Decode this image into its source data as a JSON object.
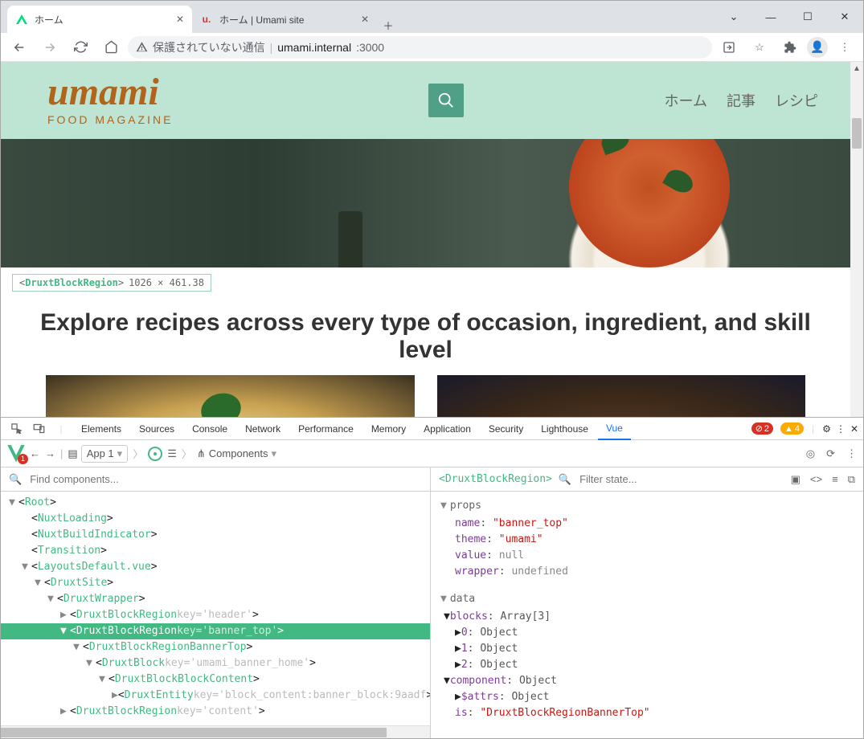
{
  "window": {
    "chevron": "⌄",
    "min": "—",
    "max": "□",
    "close": "✕"
  },
  "tabs": [
    {
      "title": "ホーム",
      "favColor": "#00dc82"
    },
    {
      "title": "ホーム | Umami site",
      "favColor": "#d93025"
    }
  ],
  "newtab": "+",
  "nav": {
    "back": "←",
    "fwd": "→",
    "reload": "⟳",
    "home": "⌂"
  },
  "urlbar": {
    "warn": "▲",
    "security": "保護されていない通信",
    "host": "umami.internal",
    "port": ":3000",
    "share": "⇪",
    "star": "☆",
    "ext": "✦",
    "menu": "⋮"
  },
  "site": {
    "logo": "umami",
    "logo_sub": "FOOD MAGAZINE",
    "menu": [
      "ホーム",
      "記事",
      "レシピ"
    ],
    "headline": "Explore recipes across every type of occasion, ingredient, and skill level"
  },
  "badge": {
    "comp": "DruxtBlockRegion",
    "dim": "1026 × 461.38"
  },
  "devtools": {
    "icons": {
      "inspect": "⬚",
      "device": "▭",
      "gear": "⚙",
      "more": "⋮",
      "close": "✕"
    },
    "tabs": [
      "Elements",
      "Sources",
      "Console",
      "Network",
      "Performance",
      "Memory",
      "Application",
      "Security",
      "Lighthouse",
      "Vue"
    ],
    "active": "Vue",
    "errors": "2",
    "warnings": "4",
    "bar": {
      "badge": "1",
      "back": "←",
      "fwd": "→",
      "app": "App 1",
      "components": "Components",
      "crosshair": "⊕",
      "refresh": "⟳",
      "menu": "⋮"
    },
    "find_placeholder": "Find components...",
    "inspected": "<DruxtBlockRegion>",
    "filter_placeholder": "Filter state...",
    "ricons": [
      "▦",
      "<>",
      "≡",
      "⧉"
    ],
    "tree": [
      {
        "d": 0,
        "a": "▼",
        "t": "Root"
      },
      {
        "d": 1,
        "a": "",
        "t": "NuxtLoading"
      },
      {
        "d": 1,
        "a": "",
        "t": "NuxtBuildIndicator"
      },
      {
        "d": 1,
        "a": "",
        "t": "Transition"
      },
      {
        "d": 1,
        "a": "▼",
        "t": "LayoutsDefault.vue"
      },
      {
        "d": 2,
        "a": "▼",
        "t": "DruxtSite"
      },
      {
        "d": 3,
        "a": "▼",
        "t": "DruxtWrapper"
      },
      {
        "d": 4,
        "a": "▶",
        "t": "DruxtBlockRegion",
        "attr": "key='header'"
      },
      {
        "d": 4,
        "a": "▼",
        "t": "DruxtBlockRegion",
        "attr": "key='banner_top'",
        "sel": true
      },
      {
        "d": 5,
        "a": "▼",
        "t": "DruxtBlockRegionBannerTop"
      },
      {
        "d": 6,
        "a": "▼",
        "t": "DruxtBlock",
        "attr": "key='umami_banner_home'"
      },
      {
        "d": 7,
        "a": "▼",
        "t": "DruxtBlockBlockContent"
      },
      {
        "d": 8,
        "a": "▶",
        "t": "DruxtEntity",
        "attr": "key='block_content:banner_block:9aadf"
      },
      {
        "d": 4,
        "a": "▶",
        "t": "DruxtBlockRegion",
        "attr": "key='content'"
      }
    ],
    "props_title": "props",
    "props": [
      {
        "k": "name",
        "v": "\"banner_top\"",
        "t": "s"
      },
      {
        "k": "theme",
        "v": "\"umami\"",
        "t": "s"
      },
      {
        "k": "value",
        "v": "null",
        "t": "n"
      },
      {
        "k": "wrapper",
        "v": "undefined",
        "t": "n"
      }
    ],
    "data_title": "data",
    "data": [
      {
        "d": 0,
        "a": "▼",
        "k": "blocks",
        "v": "Array[3]"
      },
      {
        "d": 1,
        "a": "▶",
        "k": "0",
        "v": "Object"
      },
      {
        "d": 1,
        "a": "▶",
        "k": "1",
        "v": "Object"
      },
      {
        "d": 1,
        "a": "▶",
        "k": "2",
        "v": "Object"
      },
      {
        "d": 0,
        "a": "▼",
        "k": "component",
        "v": "Object"
      },
      {
        "d": 1,
        "a": "▶",
        "k": "$attrs",
        "v": "Object"
      },
      {
        "d": 1,
        "a": "",
        "k": "is",
        "v": "\"DruxtBlockRegionBannerTop\"",
        "t": "s"
      }
    ]
  }
}
